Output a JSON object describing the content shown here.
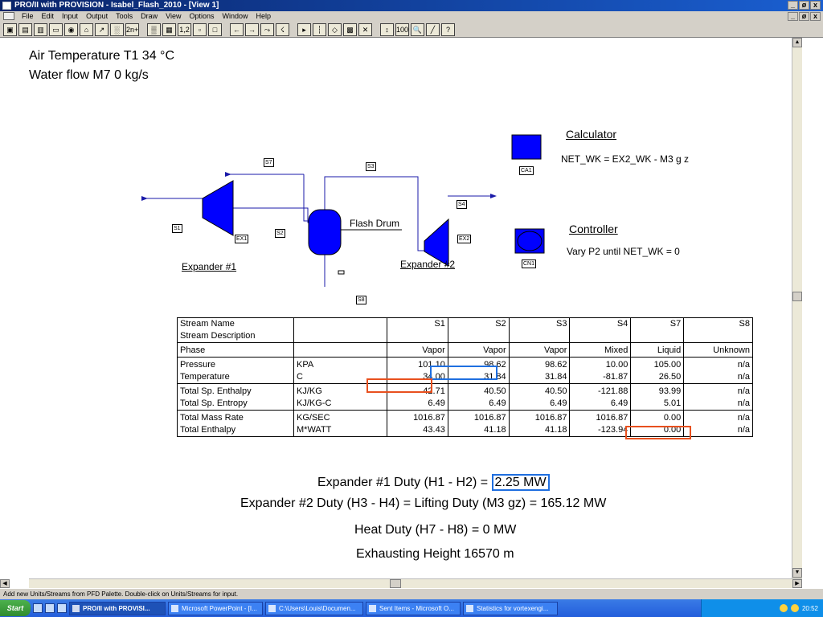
{
  "window": {
    "title": "PRO/II with PROVISION - Isabel_Flash_2010 - [View 1]",
    "controls": [
      "_",
      "ø",
      "x"
    ]
  },
  "menu": [
    "File",
    "Edit",
    "Input",
    "Output",
    "Tools",
    "Draw",
    "View",
    "Options",
    "Window",
    "Help"
  ],
  "toolbar": [
    "▣",
    "▤",
    "▥",
    "▭",
    "◉",
    "⌂",
    "↗",
    "░",
    "2n+6",
    "▒",
    "▦",
    "1,2",
    "▫",
    "□",
    "←",
    "→",
    "⤳",
    "☇",
    "▸",
    "┆",
    "◇",
    "▩",
    "✕",
    "↕",
    "100",
    "🔍",
    "╱",
    "?"
  ],
  "header": {
    "line1": "Air Temperature T1 34 °C",
    "line2": "Water flow M7 0 kg/s"
  },
  "diagram": {
    "streams": [
      "S1",
      "S2",
      "S3",
      "S4",
      "S7",
      "S8"
    ],
    "units": {
      "ex1_tag": "EX1",
      "ex2_tag": "EX2",
      "ca1_tag": "CA1",
      "cn1_tag": "CN1",
      "expander1": "Expander #1",
      "expander2": "Expander #2",
      "flash": "Flash Drum"
    },
    "calculator_title": "Calculator",
    "calculator_expr": "NET_WK = EX2_WK - M3 g z",
    "controller_title": "Controller",
    "controller_expr": "Vary P2 until NET_WK = 0",
    "colors": {
      "unit_fill": "#0000ff",
      "stream": "#1a1aa8"
    }
  },
  "table": {
    "header": [
      "Stream Name",
      "",
      "S1",
      "S2",
      "S3",
      "S4",
      "S7",
      "S8"
    ],
    "header2": [
      "Stream Description",
      "",
      "",
      "",
      "",
      "",
      "",
      ""
    ],
    "groups": [
      [
        [
          "Phase",
          "",
          "Vapor",
          "Vapor",
          "Vapor",
          "Mixed",
          "Liquid",
          "Unknown"
        ]
      ],
      [
        [
          "Pressure",
          "KPA",
          "101.10",
          "98.62",
          "98.62",
          "10.00",
          "105.00",
          "n/a"
        ],
        [
          "Temperature",
          "C",
          "34.00",
          "31.84",
          "31.84",
          "-81.87",
          "26.50",
          "n/a"
        ]
      ],
      [
        [
          "Total Sp. Enthalpy",
          "KJ/KG",
          "42.71",
          "40.50",
          "40.50",
          "-121.88",
          "93.99",
          "n/a"
        ],
        [
          "Total Sp. Entropy",
          "KJ/KG-C",
          "6.49",
          "6.49",
          "6.49",
          "6.49",
          "5.01",
          "n/a"
        ]
      ],
      [
        [
          "Total Mass Rate",
          "KG/SEC",
          "1016.87",
          "1016.87",
          "1016.87",
          "1016.87",
          "0.00",
          "n/a"
        ],
        [
          "Total Enthalpy",
          "M*WATT",
          "43.43",
          "41.18",
          "41.18",
          "-123.94",
          "0.00",
          "n/a"
        ]
      ]
    ],
    "highlight_colors": {
      "blue": "#1f6fe0",
      "red": "#e8501e"
    }
  },
  "duties": {
    "d1_label": "Expander #1 Duty  (H1 - H2) = ",
    "d1_value": "2.25 MW",
    "d2": "Expander #2 Duty  (H3 - H4) = Lifting Duty (M3 gz) =  165.12 MW",
    "d3": "Heat Duty (H7 - H8) = 0 MW",
    "d4": "Exhausting Height 16570 m"
  },
  "status": "Add new Units/Streams from PFD Palette.  Double-click on Units/Streams for input.",
  "taskbar": {
    "start": "Start",
    "tasks": [
      "PRO/II with PROVISI...",
      "Microsoft PowerPoint - [I...",
      "C:\\Users\\Louis\\Documen...",
      "Sent Items - Microsoft O...",
      "Statistics for vortexengi..."
    ],
    "clock": "20:52"
  }
}
